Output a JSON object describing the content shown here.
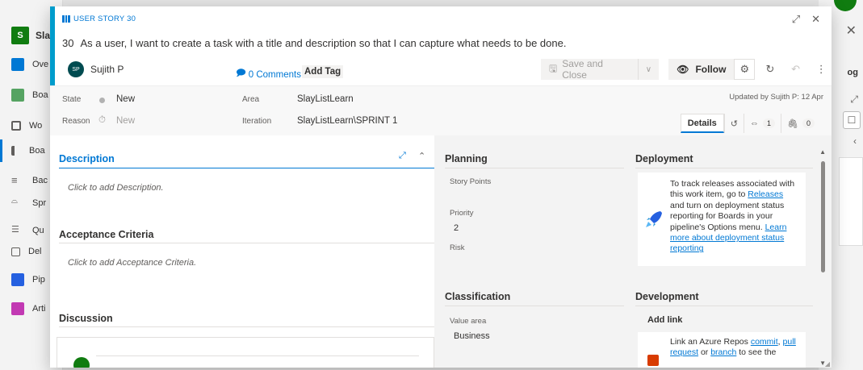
{
  "background": {
    "org_initial": "S",
    "org_name": "Slay",
    "nav": [
      {
        "label": "Ove",
        "color": "#0078d4"
      },
      {
        "label": "Boa",
        "color": "#55a362"
      },
      {
        "label": "Wo",
        "color": "#605e5c"
      },
      {
        "label": "Boa",
        "color": "#605e5c"
      },
      {
        "label": "Bac",
        "color": "#605e5c"
      },
      {
        "label": "Spr",
        "color": "#605e5c"
      },
      {
        "label": "Qu",
        "color": "#605e5c"
      },
      {
        "label": "Del",
        "color": "#605e5c"
      },
      {
        "label": "Pip",
        "color": "#2560e0"
      },
      {
        "label": "Arti",
        "color": "#c239b3"
      }
    ],
    "right_tag": "og"
  },
  "header": {
    "type_label": "USER STORY 30",
    "id": "30",
    "title": "As a user, I want to create a task with a title and description so that I can capture what needs to be done.",
    "assignee_initials": "SP",
    "assignee": "Sujith P",
    "comments": "0 Comments",
    "add_tag": "Add Tag",
    "save_close": "Save and Close",
    "follow": "Follow"
  },
  "fields": {
    "state_label": "State",
    "state_value": "New",
    "reason_label": "Reason",
    "reason_value": "New",
    "area_label": "Area",
    "area_value": "SlayListLearn",
    "iteration_label": "Iteration",
    "iteration_value": "SlayListLearn\\SPRINT 1",
    "updated": "Updated by Sujith P: 12 Apr"
  },
  "tabs": {
    "details": "Details",
    "links_count": "1",
    "attachments_count": "0"
  },
  "left": {
    "description_title": "Description",
    "description_placeholder": "Click to add Description.",
    "acceptance_title": "Acceptance Criteria",
    "acceptance_placeholder": "Click to add Acceptance Criteria.",
    "discussion_title": "Discussion"
  },
  "planning": {
    "title": "Planning",
    "story_points_label": "Story Points",
    "priority_label": "Priority",
    "priority_value": "2",
    "risk_label": "Risk"
  },
  "classification": {
    "title": "Classification",
    "value_area_label": "Value area",
    "value_area_value": "Business"
  },
  "deployment": {
    "title": "Deployment",
    "text1": "To track releases associated with this work item, go to",
    "link_releases": "Releases",
    "text2": "and turn on deployment status reporting for Boards in your pipeline's Options menu.",
    "link_learn": "Learn more about deployment status reporting"
  },
  "development": {
    "title": "Development",
    "add_link": "Add link",
    "text1": "Link an Azure Repos",
    "link_commit": "commit",
    "sep1": ",",
    "link_pr": "pull request",
    "text2": "or",
    "link_branch": "branch",
    "text3": "to see the"
  }
}
